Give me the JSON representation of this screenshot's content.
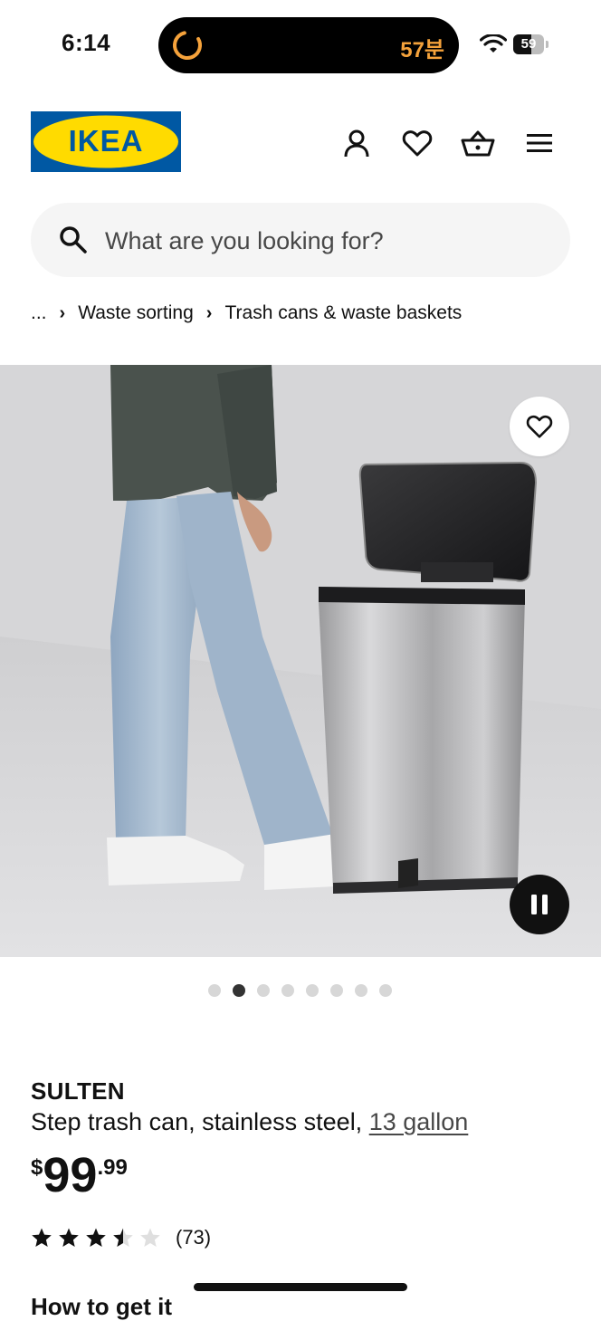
{
  "status_bar": {
    "time": "6:14",
    "island_text": "57분",
    "battery": "59",
    "battery_level": 0.59,
    "icons": [
      "timer-ring-icon",
      "wifi-icon",
      "battery-icon"
    ]
  },
  "header": {
    "logo_text": "IKEA",
    "icons": [
      "account-icon",
      "favorites-heart-icon",
      "cart-basket-icon",
      "menu-hamburger-icon"
    ]
  },
  "search": {
    "placeholder": "What are you looking for?"
  },
  "breadcrumb": {
    "ellipsis": "...",
    "items": [
      "Waste sorting",
      "Trash cans & waste baskets"
    ]
  },
  "gallery": {
    "dot_count": 8,
    "active_index": 1
  },
  "product": {
    "name": "SULTEN",
    "description": "Step trash can, stainless steel,",
    "size_link": "13 gallon",
    "price": {
      "currency": "$",
      "integer": "99",
      "decimals": ".99"
    },
    "rating": {
      "value": 3.5,
      "max": 5,
      "count_text": "(73)"
    },
    "next_heading": "How to get it"
  },
  "colors": {
    "ikea_blue": "#0058a3",
    "ikea_yellow": "#ffdb00",
    "island_accent": "#f5a23b"
  }
}
